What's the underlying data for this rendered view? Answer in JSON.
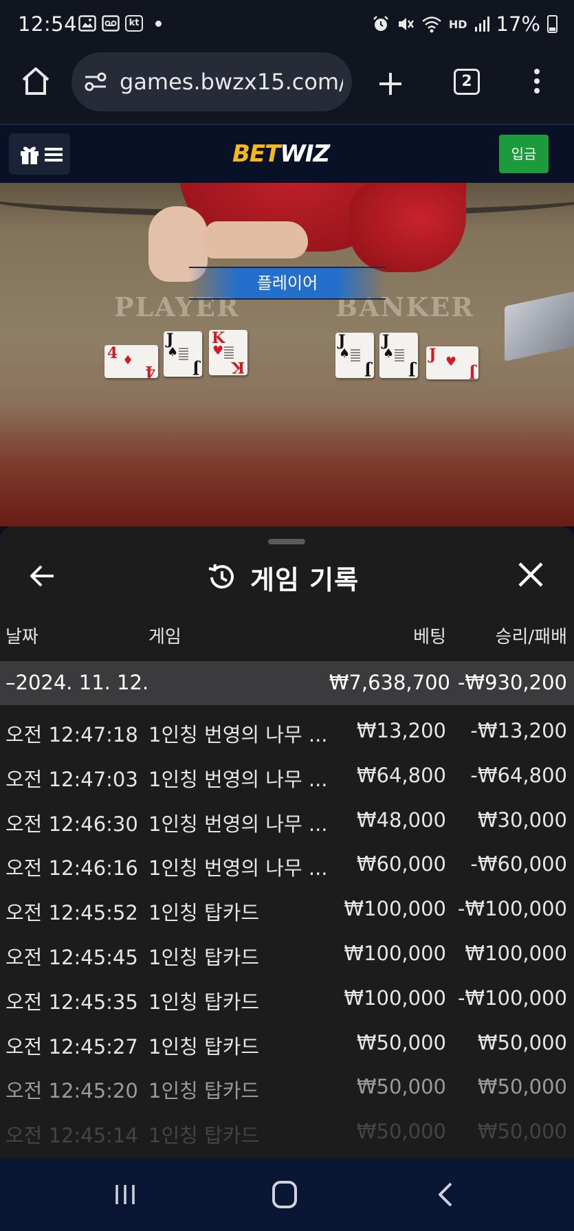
{
  "status_bar": {
    "time": "12:54",
    "carrier_badge": "kt",
    "battery": "17%",
    "hd_label": "HD"
  },
  "browser": {
    "url": "games.bwzx15.com/l",
    "tab_count": "2"
  },
  "site_header": {
    "brand_part1": "BET",
    "brand_part2": "WIZ",
    "deposit_label": "입금",
    "accent_color": "#f6b81c",
    "deposit_color": "#1d9a3c"
  },
  "game_view": {
    "result_label": "플레이어",
    "player_label": "PLAYER",
    "banker_label": "BANKER",
    "player_cards": [
      {
        "rank": "4",
        "suit": "♦",
        "color": "red"
      },
      {
        "rank": "J",
        "suit": "♠",
        "color": "black"
      },
      {
        "rank": "K",
        "suit": "♥",
        "color": "red"
      }
    ],
    "banker_cards": [
      {
        "rank": "J",
        "suit": "♠",
        "color": "black"
      },
      {
        "rank": "J",
        "suit": "♠",
        "color": "black"
      },
      {
        "rank": "J",
        "suit": "♥",
        "color": "red"
      }
    ]
  },
  "history": {
    "title": "게임 기록",
    "columns": {
      "date": "날짜",
      "game": "게임",
      "bet": "베팅",
      "winloss": "승리/패배"
    },
    "date_group": {
      "date": "–2024. 11. 12.",
      "bet_total": "₩7,638,700",
      "winloss_total": "-₩930,200"
    },
    "rows": [
      {
        "time": "오전 12:47:18",
        "game": "1인칭 번영의 나무 ...",
        "bet": "₩13,200",
        "winloss": "-₩13,200"
      },
      {
        "time": "오전 12:47:03",
        "game": "1인칭 번영의 나무 ...",
        "bet": "₩64,800",
        "winloss": "-₩64,800"
      },
      {
        "time": "오전 12:46:30",
        "game": "1인칭 번영의 나무 ...",
        "bet": "₩48,000",
        "winloss": "₩30,000"
      },
      {
        "time": "오전 12:46:16",
        "game": "1인칭 번영의 나무 ...",
        "bet": "₩60,000",
        "winloss": "-₩60,000"
      },
      {
        "time": "오전 12:45:52",
        "game": "1인칭 탑카드",
        "bet": "₩100,000",
        "winloss": "-₩100,000"
      },
      {
        "time": "오전 12:45:45",
        "game": "1인칭 탑카드",
        "bet": "₩100,000",
        "winloss": "₩100,000"
      },
      {
        "time": "오전 12:45:35",
        "game": "1인칭 탑카드",
        "bet": "₩100,000",
        "winloss": "-₩100,000"
      },
      {
        "time": "오전 12:45:27",
        "game": "1인칭 탑카드",
        "bet": "₩50,000",
        "winloss": "₩50,000"
      },
      {
        "time": "오전 12:45:20",
        "game": "1인칭 탑카드",
        "bet": "₩50,000",
        "winloss": "₩50,000"
      },
      {
        "time": "오전 12:45:14",
        "game": "1인칭 탑카드",
        "bet": "₩50,000",
        "winloss": "₩50,000"
      }
    ]
  }
}
